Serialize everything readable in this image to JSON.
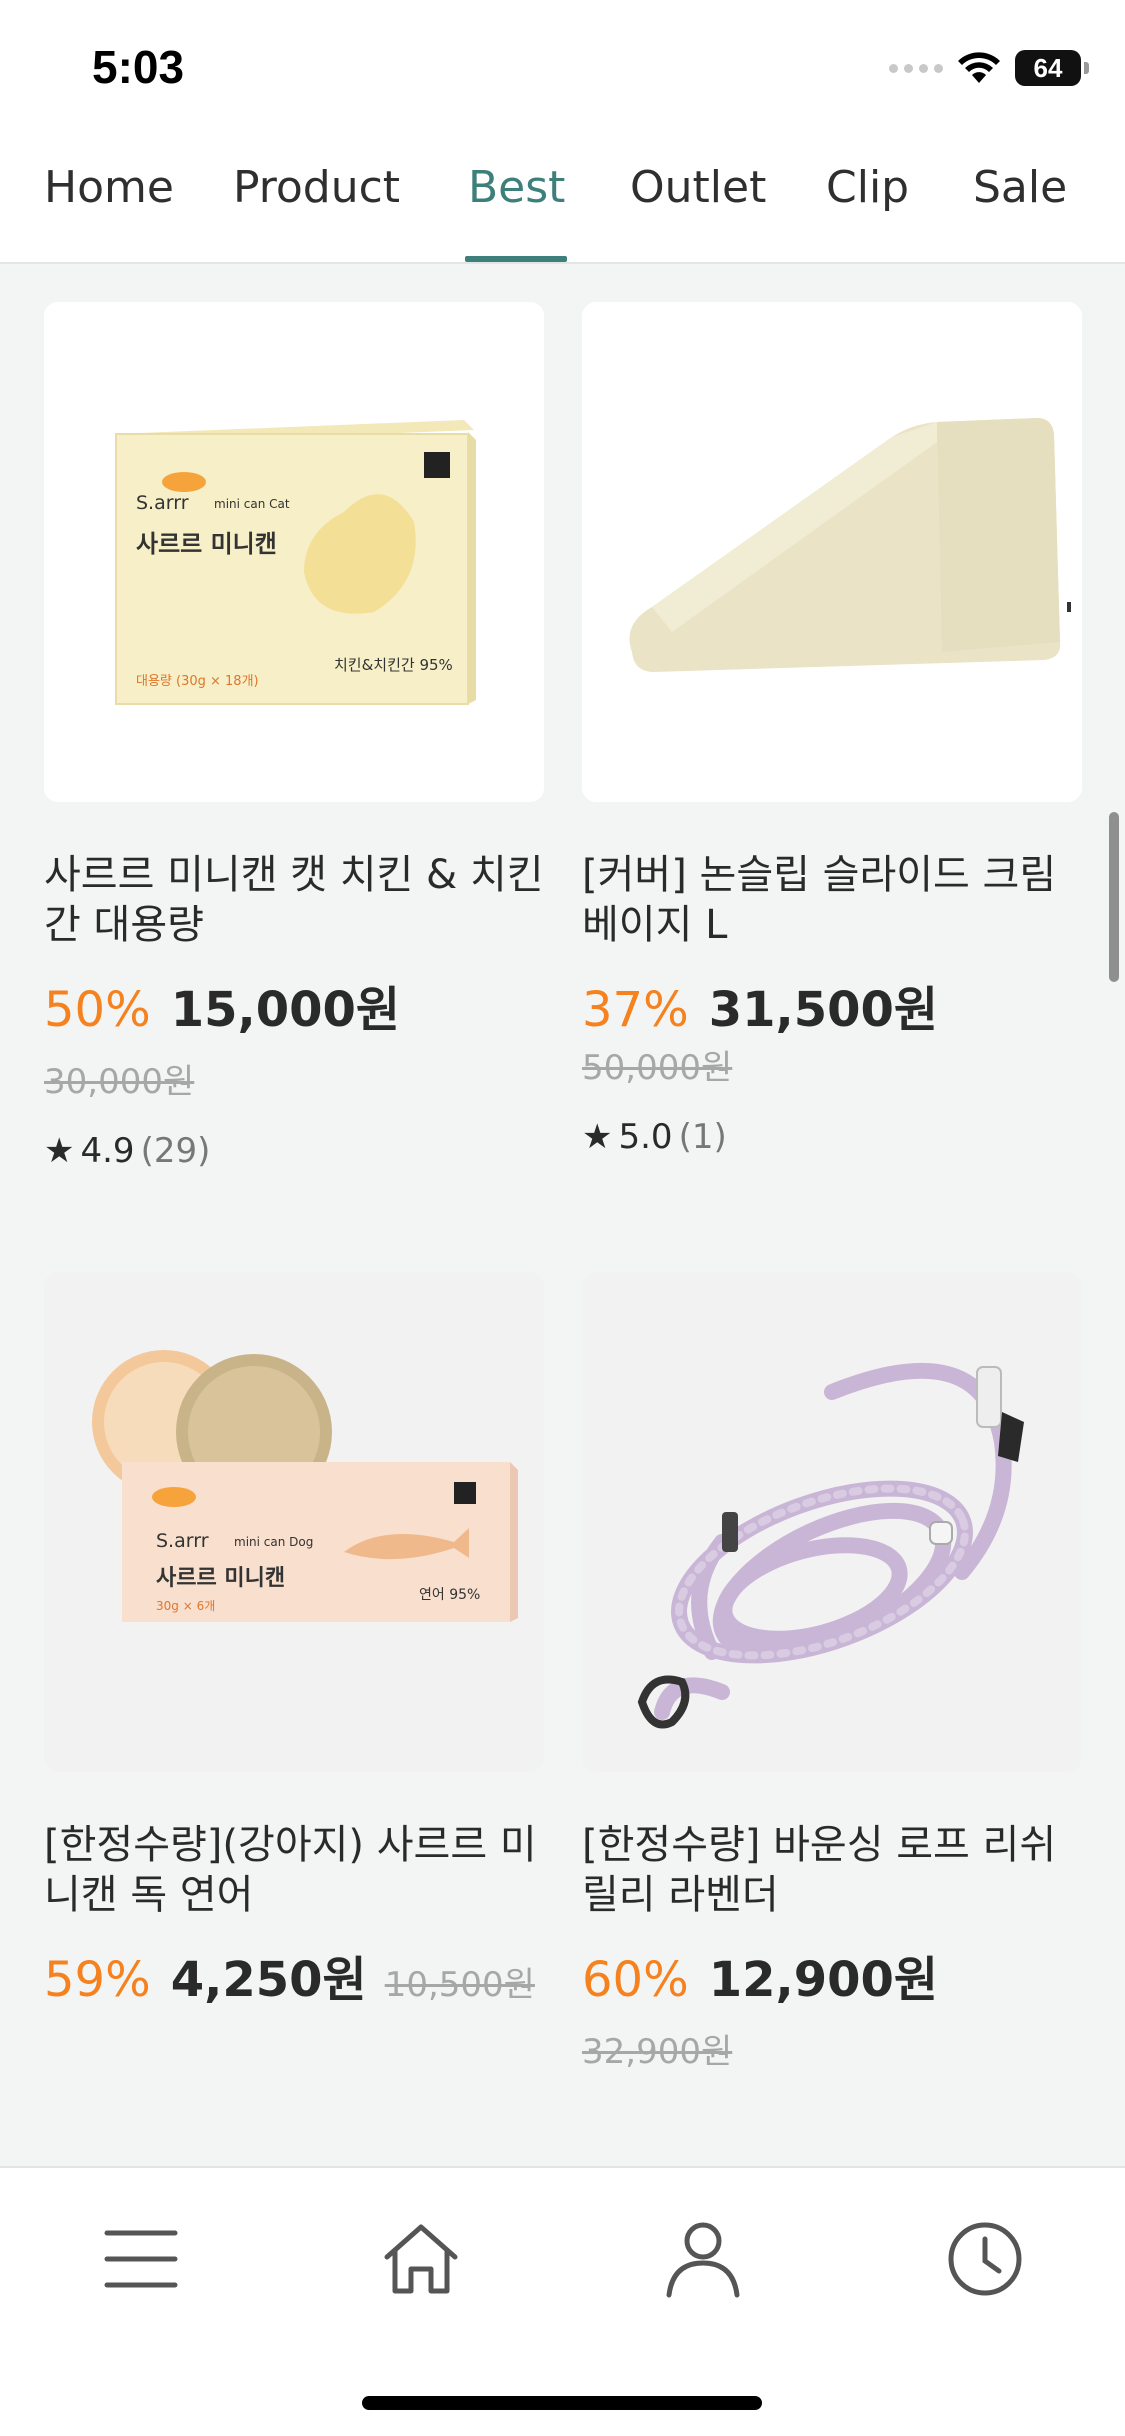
{
  "status_bar": {
    "time": "5:03",
    "battery": "64"
  },
  "tabs": [
    {
      "label": "Home"
    },
    {
      "label": "Product"
    },
    {
      "label": "Best"
    },
    {
      "label": "Outlet"
    },
    {
      "label": "Clip"
    },
    {
      "label": "Sale"
    }
  ],
  "active_tab": "Best",
  "products": [
    {
      "title": "사르르 미니캔 캣 치킨 & 치킨간 대용량",
      "discount": "50%",
      "price": "15,000원",
      "original_price": "30,000원",
      "rating": "4.9",
      "reviews": "(29)",
      "image_icon": "cat-food-box-image",
      "box_brand": "S.arrr",
      "box_sub": "mini can Cat",
      "box_name": "사르르 미니캔",
      "box_flavor": "치킨&치킨간 95%",
      "box_size": "대용량 (30g × 18개)"
    },
    {
      "title": "[커버] 논슬립 슬라이드 크림 베이지 L",
      "discount": "37%",
      "price": "31,500원",
      "original_price": "50,000원",
      "rating": "5.0",
      "reviews": "(1)",
      "image_icon": "pet-ramp-image"
    },
    {
      "title": "[한정수량](강아지) 사르르 미니캔 독 연어",
      "discount": "59%",
      "price": "4,250원",
      "original_price": "10,500원",
      "image_icon": "dog-food-box-image",
      "box_brand": "S.arrr",
      "box_sub": "mini can Dog",
      "box_name": "사르르 미니캔",
      "box_flavor": "연어 95%",
      "box_size": "30g × 6개"
    },
    {
      "title": "[한정수량] 바운싱 로프 리쉬 릴리 라벤더",
      "discount": "60%",
      "price": "12,900원",
      "original_price": "32,900원",
      "image_icon": "rope-leash-image"
    }
  ],
  "colors": {
    "accent": "#3d7f7a",
    "discount": "#f5821f",
    "strike": "#a7a7a7",
    "background": "#f3f5f5"
  },
  "bottom_nav": [
    {
      "icon": "menu-icon"
    },
    {
      "icon": "home-icon"
    },
    {
      "icon": "user-icon"
    },
    {
      "icon": "clock-icon"
    }
  ]
}
